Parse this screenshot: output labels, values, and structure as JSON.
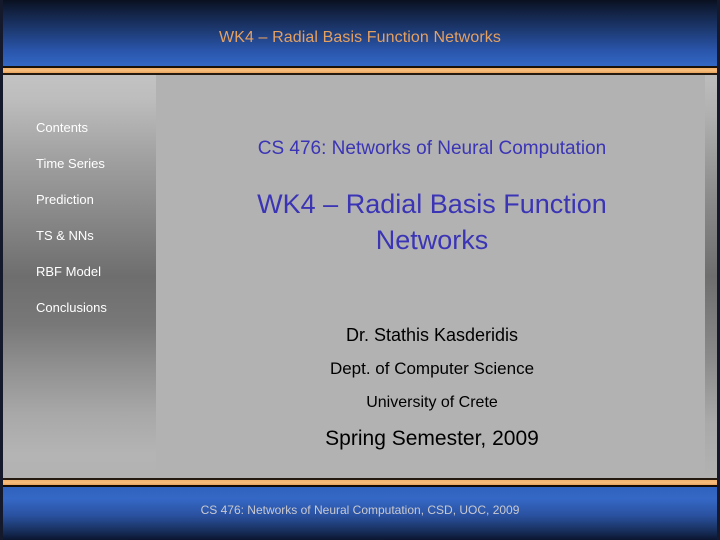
{
  "header": {
    "title": "WK4 – Radial Basis Function Networks"
  },
  "sidebar": {
    "items": [
      {
        "label": "Contents"
      },
      {
        "label": "Time Series"
      },
      {
        "label": "Prediction"
      },
      {
        "label": "TS & NNs"
      },
      {
        "label": "RBF Model"
      },
      {
        "label": "Conclusions"
      }
    ]
  },
  "content": {
    "course": "CS 476: Networks of Neural Computation",
    "deck_title_line1": "WK4 – Radial Basis Function",
    "deck_title_line2": "Networks",
    "author_name": "Dr. Stathis Kasderidis",
    "author_dept": "Dept. of Computer Science",
    "author_university": "University of Crete",
    "term": "Spring Semester, 2009"
  },
  "footer": {
    "text": "CS 476: Networks of Neural Computation, CSD, UOC, 2009"
  },
  "colors": {
    "header_title": "#e4a061",
    "heading_blue": "#3b35b5",
    "accent_orange": "#f4b873",
    "body_gray": "#b2b2b2",
    "footer_text": "#c9c9cf"
  }
}
